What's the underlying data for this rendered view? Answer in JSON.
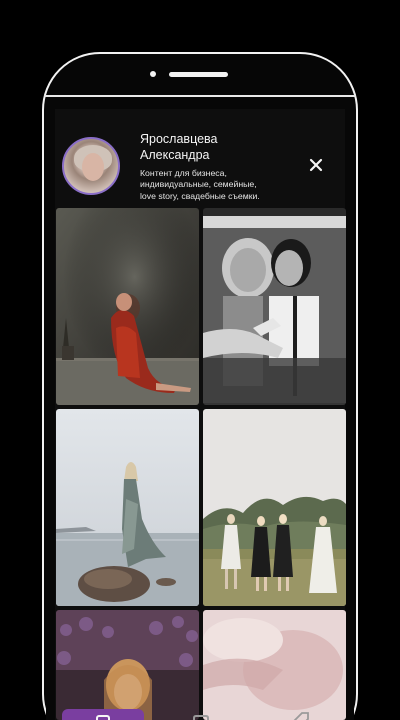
{
  "profile": {
    "name": "Ярославцева\nАлександра",
    "description": "Контент для бизнеса,\nиндивидуальные, семейные,\nlove story, свадебные съемки."
  },
  "icons": {
    "close": "close-icon",
    "nav_home": "home-icon",
    "nav_second": "bookmark-icon",
    "nav_third": "tag-icon"
  },
  "colors": {
    "accent": "#7a3ea0",
    "avatar_ring": "#8a6ec8",
    "background": "#0e0e0e",
    "text": "#f4f4f4"
  }
}
